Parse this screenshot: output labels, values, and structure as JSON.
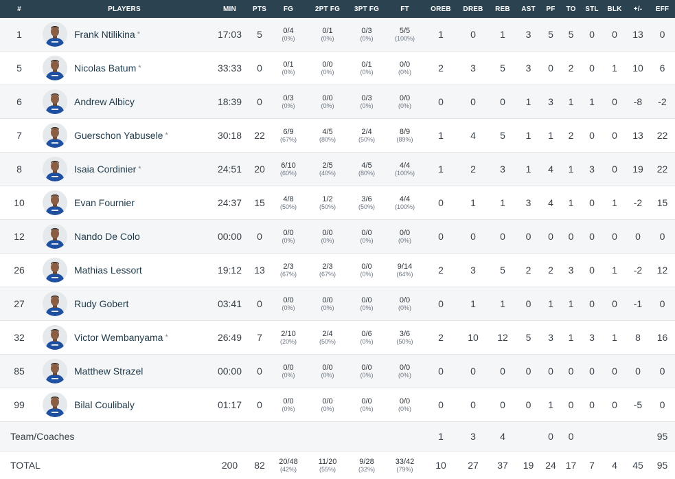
{
  "headers": [
    "#",
    "PLAYERS",
    "MIN",
    "PTS",
    "FG",
    "2PT FG",
    "3PT FG",
    "FT",
    "OREB",
    "DREB",
    "REB",
    "AST",
    "PF",
    "TO",
    "STL",
    "BLK",
    "+/-",
    "EFF"
  ],
  "players": [
    {
      "num": "1",
      "name": "Frank Ntilikina",
      "star": "*",
      "min": "17:03",
      "pts": "5",
      "fg": "0/4",
      "fgp": "(0%)",
      "fg2": "0/1",
      "fg2p": "(0%)",
      "fg3": "0/3",
      "fg3p": "(0%)",
      "ft": "5/5",
      "ftp": "(100%)",
      "oreb": "1",
      "dreb": "0",
      "reb": "1",
      "ast": "3",
      "pf": "5",
      "to": "5",
      "stl": "0",
      "blk": "0",
      "pm": "13",
      "eff": "0"
    },
    {
      "num": "5",
      "name": "Nicolas Batum",
      "star": "*",
      "min": "33:33",
      "pts": "0",
      "fg": "0/1",
      "fgp": "(0%)",
      "fg2": "0/0",
      "fg2p": "(0%)",
      "fg3": "0/1",
      "fg3p": "(0%)",
      "ft": "0/0",
      "ftp": "(0%)",
      "oreb": "2",
      "dreb": "3",
      "reb": "5",
      "ast": "3",
      "pf": "0",
      "to": "2",
      "stl": "0",
      "blk": "1",
      "pm": "10",
      "eff": "6"
    },
    {
      "num": "6",
      "name": "Andrew Albicy",
      "star": "",
      "min": "18:39",
      "pts": "0",
      "fg": "0/3",
      "fgp": "(0%)",
      "fg2": "0/0",
      "fg2p": "(0%)",
      "fg3": "0/3",
      "fg3p": "(0%)",
      "ft": "0/0",
      "ftp": "(0%)",
      "oreb": "0",
      "dreb": "0",
      "reb": "0",
      "ast": "1",
      "pf": "3",
      "to": "1",
      "stl": "1",
      "blk": "0",
      "pm": "-8",
      "eff": "-2"
    },
    {
      "num": "7",
      "name": "Guerschon Yabusele",
      "star": "*",
      "min": "30:18",
      "pts": "22",
      "fg": "6/9",
      "fgp": "(67%)",
      "fg2": "4/5",
      "fg2p": "(80%)",
      "fg3": "2/4",
      "fg3p": "(50%)",
      "ft": "8/9",
      "ftp": "(89%)",
      "oreb": "1",
      "dreb": "4",
      "reb": "5",
      "ast": "1",
      "pf": "1",
      "to": "2",
      "stl": "0",
      "blk": "0",
      "pm": "13",
      "eff": "22"
    },
    {
      "num": "8",
      "name": "Isaia Cordinier",
      "star": "*",
      "min": "24:51",
      "pts": "20",
      "fg": "6/10",
      "fgp": "(60%)",
      "fg2": "2/5",
      "fg2p": "(40%)",
      "fg3": "4/5",
      "fg3p": "(80%)",
      "ft": "4/4",
      "ftp": "(100%)",
      "oreb": "1",
      "dreb": "2",
      "reb": "3",
      "ast": "1",
      "pf": "4",
      "to": "1",
      "stl": "3",
      "blk": "0",
      "pm": "19",
      "eff": "22"
    },
    {
      "num": "10",
      "name": "Evan Fournier",
      "star": "",
      "min": "24:37",
      "pts": "15",
      "fg": "4/8",
      "fgp": "(50%)",
      "fg2": "1/2",
      "fg2p": "(50%)",
      "fg3": "3/6",
      "fg3p": "(50%)",
      "ft": "4/4",
      "ftp": "(100%)",
      "oreb": "0",
      "dreb": "1",
      "reb": "1",
      "ast": "3",
      "pf": "4",
      "to": "1",
      "stl": "0",
      "blk": "1",
      "pm": "-2",
      "eff": "15"
    },
    {
      "num": "12",
      "name": "Nando De Colo",
      "star": "",
      "min": "00:00",
      "pts": "0",
      "fg": "0/0",
      "fgp": "(0%)",
      "fg2": "0/0",
      "fg2p": "(0%)",
      "fg3": "0/0",
      "fg3p": "(0%)",
      "ft": "0/0",
      "ftp": "(0%)",
      "oreb": "0",
      "dreb": "0",
      "reb": "0",
      "ast": "0",
      "pf": "0",
      "to": "0",
      "stl": "0",
      "blk": "0",
      "pm": "0",
      "eff": "0"
    },
    {
      "num": "26",
      "name": "Mathias Lessort",
      "star": "",
      "min": "19:12",
      "pts": "13",
      "fg": "2/3",
      "fgp": "(67%)",
      "fg2": "2/3",
      "fg2p": "(67%)",
      "fg3": "0/0",
      "fg3p": "(0%)",
      "ft": "9/14",
      "ftp": "(64%)",
      "oreb": "2",
      "dreb": "3",
      "reb": "5",
      "ast": "2",
      "pf": "2",
      "to": "3",
      "stl": "0",
      "blk": "1",
      "pm": "-2",
      "eff": "12"
    },
    {
      "num": "27",
      "name": "Rudy Gobert",
      "star": "",
      "min": "03:41",
      "pts": "0",
      "fg": "0/0",
      "fgp": "(0%)",
      "fg2": "0/0",
      "fg2p": "(0%)",
      "fg3": "0/0",
      "fg3p": "(0%)",
      "ft": "0/0",
      "ftp": "(0%)",
      "oreb": "0",
      "dreb": "1",
      "reb": "1",
      "ast": "0",
      "pf": "1",
      "to": "1",
      "stl": "0",
      "blk": "0",
      "pm": "-1",
      "eff": "0"
    },
    {
      "num": "32",
      "name": "Victor Wembanyama",
      "star": "*",
      "min": "26:49",
      "pts": "7",
      "fg": "2/10",
      "fgp": "(20%)",
      "fg2": "2/4",
      "fg2p": "(50%)",
      "fg3": "0/6",
      "fg3p": "(0%)",
      "ft": "3/6",
      "ftp": "(50%)",
      "oreb": "2",
      "dreb": "10",
      "reb": "12",
      "ast": "5",
      "pf": "3",
      "to": "1",
      "stl": "3",
      "blk": "1",
      "pm": "8",
      "eff": "16"
    },
    {
      "num": "85",
      "name": "Matthew Strazel",
      "star": "",
      "min": "00:00",
      "pts": "0",
      "fg": "0/0",
      "fgp": "(0%)",
      "fg2": "0/0",
      "fg2p": "(0%)",
      "fg3": "0/0",
      "fg3p": "(0%)",
      "ft": "0/0",
      "ftp": "(0%)",
      "oreb": "0",
      "dreb": "0",
      "reb": "0",
      "ast": "0",
      "pf": "0",
      "to": "0",
      "stl": "0",
      "blk": "0",
      "pm": "0",
      "eff": "0"
    },
    {
      "num": "99",
      "name": "Bilal Coulibaly",
      "star": "",
      "min": "01:17",
      "pts": "0",
      "fg": "0/0",
      "fgp": "(0%)",
      "fg2": "0/0",
      "fg2p": "(0%)",
      "fg3": "0/0",
      "fg3p": "(0%)",
      "ft": "0/0",
      "ftp": "(0%)",
      "oreb": "0",
      "dreb": "0",
      "reb": "0",
      "ast": "0",
      "pf": "1",
      "to": "0",
      "stl": "0",
      "blk": "0",
      "pm": "-5",
      "eff": "0"
    }
  ],
  "team": {
    "label": "Team/Coaches",
    "oreb": "1",
    "dreb": "3",
    "reb": "4",
    "pf": "0",
    "to": "0",
    "eff": "95"
  },
  "total": {
    "label": "TOTAL",
    "min": "200",
    "pts": "82",
    "fg": "20/48",
    "fgp": "(42%)",
    "fg2": "11/20",
    "fg2p": "(55%)",
    "fg3": "9/28",
    "fg3p": "(32%)",
    "ft": "33/42",
    "ftp": "(79%)",
    "oreb": "10",
    "dreb": "27",
    "reb": "37",
    "ast": "19",
    "pf": "24",
    "to": "17",
    "stl": "7",
    "blk": "4",
    "pm": "45",
    "eff": "95"
  },
  "colors": {
    "header_bg": "#2b4250",
    "jersey": "#1f4fa0",
    "row_alt": "#f4f6f7"
  },
  "icons": {
    "avatar": "player-headshot-icon"
  }
}
